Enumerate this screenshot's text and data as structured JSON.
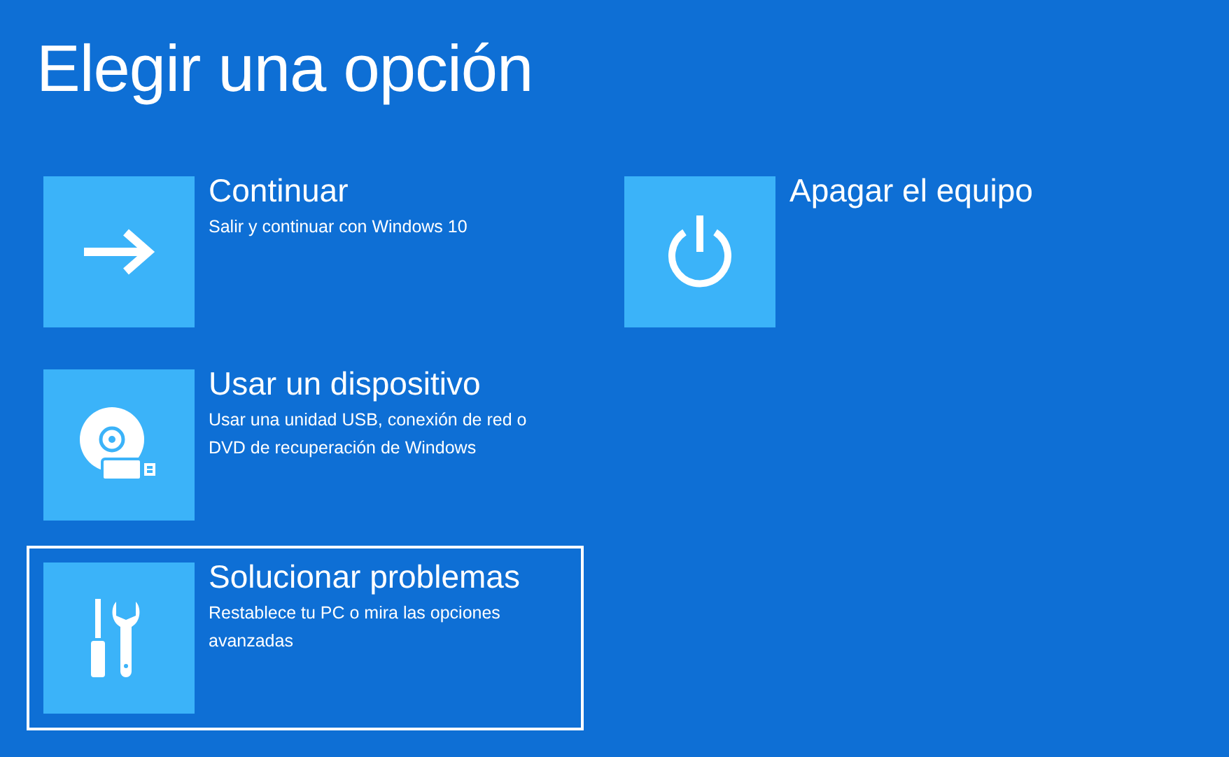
{
  "title": "Elegir una opción",
  "options": [
    {
      "kind": "arrow",
      "label": "Continuar",
      "description": "Salir y continuar con Windows 10",
      "selected": false
    },
    {
      "kind": "device",
      "label": "Usar un dispositivo",
      "description": "Usar una unidad USB, conexión de red o DVD de recuperación de Windows",
      "selected": false
    },
    {
      "kind": "tools",
      "label": "Solucionar problemas",
      "description": "Restablece tu PC o mira las opciones avanzadas",
      "selected": true
    },
    {
      "kind": "power",
      "label": "Apagar el equipo",
      "selected": false
    }
  ]
}
